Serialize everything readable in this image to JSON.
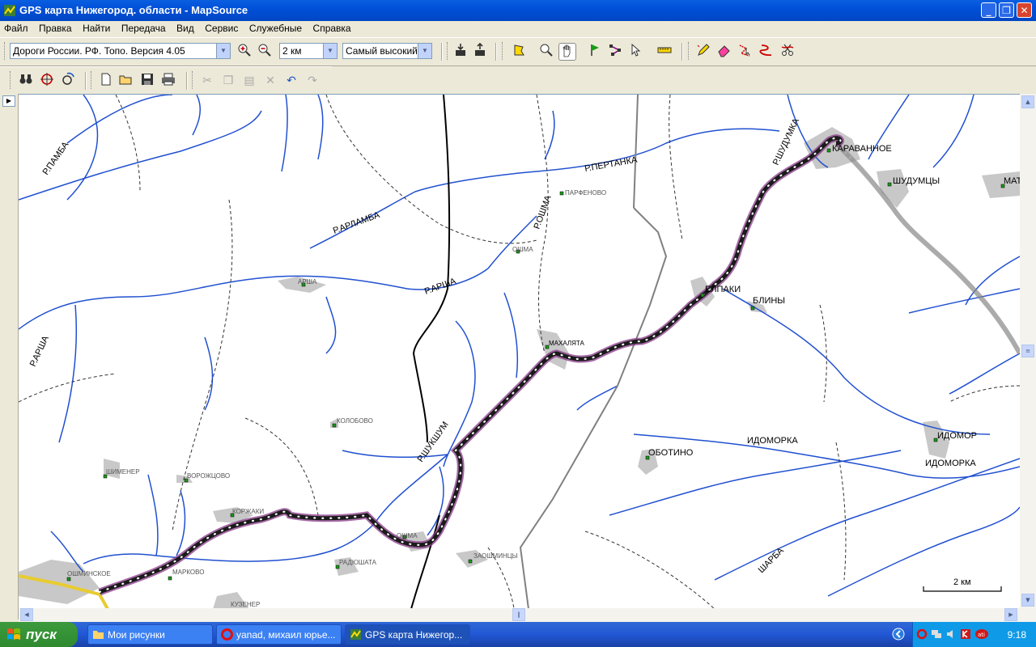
{
  "window": {
    "title": "GPS карта Нижегород. области - MapSource"
  },
  "menu": [
    "Файл",
    "Правка",
    "Найти",
    "Передача",
    "Вид",
    "Сервис",
    "Служебные",
    "Справка"
  ],
  "toolbar": {
    "map_product": "Дороги России. РФ. Топо. Версия 4.05",
    "zoom": "2 км",
    "detail": "Самый высокий"
  },
  "map": {
    "rivers": [
      "Р.ПАМБА",
      "Р.АРЛАМБА",
      "Р.АРША",
      "Р.АРША",
      "Р.ПЕРТАНКА",
      "Р.ОШМА",
      "Р.ШУДУМКА",
      "Р.ШУКШУМ",
      "ИДОМОРКА",
      "ИДОМОРКА",
      "ШАРБА"
    ],
    "places_big": [
      "КАРАВАННОЕ",
      "ШУДУМЦЫ",
      "МАТ",
      "ЕЛПАКИ",
      "БЛИНЫ",
      "МАХАЛЯТА",
      "ОБОТИНО",
      "ИДОМОР"
    ],
    "places_small": [
      "ПАРФЕНОВО",
      "ОШМА",
      "АРША",
      "КОЛОБОВО",
      "ШИМЕНЕР",
      "ВОРОЖЦОВО",
      "КОРЖАКИ",
      "ОШМА",
      "РАДЮШАТА",
      "ЗАОШМИНЦЫ",
      "ОШМИНСКОЕ",
      "МАРКОВО",
      "КУЗЕНЕР"
    ],
    "scale_label": "2 км"
  },
  "taskbar": {
    "start": "пуск",
    "tasks": [
      "Мои рисунки",
      "yanad, михаил юрье...",
      "GPS карта Нижегор..."
    ],
    "clock": "9:18"
  }
}
